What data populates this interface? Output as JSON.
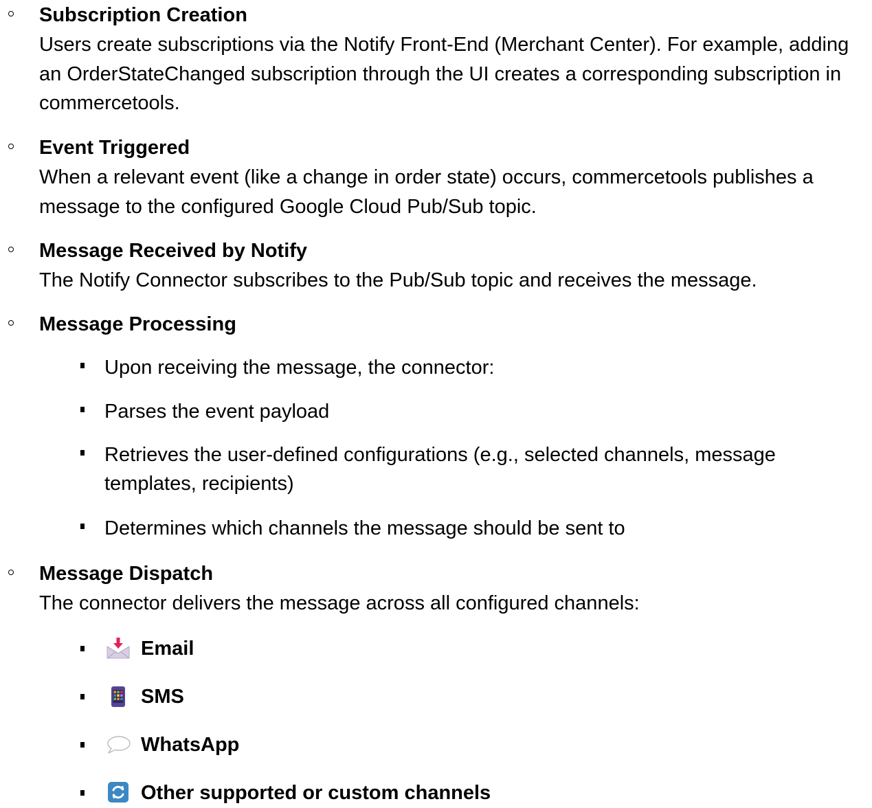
{
  "steps": [
    {
      "title": "Subscription Creation",
      "description": "Users create subscriptions via the Notify Front-End (Merchant Center). For example, adding an OrderStateChanged subscription through the UI creates a corresponding subscription in commercetools."
    },
    {
      "title": "Event Triggered",
      "description": "When a relevant event (like a change in order state) occurs, commercetools publishes a message to the configured Google Cloud Pub/Sub topic."
    },
    {
      "title": "Message Received by Notify",
      "description": "The Notify Connector subscribes to the Pub/Sub topic and receives the message."
    },
    {
      "title": "Message Processing",
      "items": [
        "Upon receiving the message, the connector:",
        "Parses the event payload",
        "Retrieves the user-defined configurations (e.g., selected channels, message templates, recipients)",
        "Determines which channels the message should be sent to"
      ]
    },
    {
      "title": "Message Dispatch",
      "description": "The connector delivers the message across all configured channels:",
      "channels": [
        {
          "icon": "envelope-with-arrow-icon",
          "label": "Email"
        },
        {
          "icon": "mobile-phone-icon",
          "label": "SMS"
        },
        {
          "icon": "speech-balloon-icon",
          "label": "WhatsApp"
        },
        {
          "icon": "refresh-arrows-icon",
          "label": "Other supported or custom channels"
        }
      ]
    }
  ],
  "colors": {
    "text": "#000000",
    "envelope_arrow": "#e0245e",
    "phone_body": "#55449a",
    "refresh_button": "#3b88c3"
  }
}
